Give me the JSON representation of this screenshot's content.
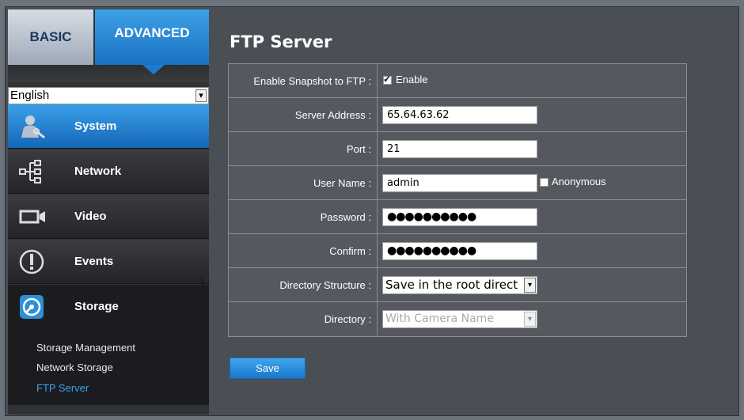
{
  "tabs": {
    "basic": "BASIC",
    "advanced": "ADVANCED"
  },
  "language": {
    "selected": "English",
    "arrow": "▾"
  },
  "nav": [
    {
      "label": "System",
      "icon": "system-icon",
      "active": true
    },
    {
      "label": "Network",
      "icon": "network-icon",
      "active": false
    },
    {
      "label": "Video",
      "icon": "video-icon",
      "active": false
    },
    {
      "label": "Events",
      "icon": "events-icon",
      "active": false
    },
    {
      "label": "Storage",
      "icon": "storage-icon",
      "active": false
    }
  ],
  "submenu": [
    {
      "label": "Storage Management",
      "active": false
    },
    {
      "label": "Network Storage",
      "active": false
    },
    {
      "label": "FTP Server",
      "active": true
    }
  ],
  "page": {
    "title": "FTP Server"
  },
  "form": {
    "snapshot": {
      "label": "Enable Snapshot to FTP :",
      "checkbox_label": "Enable",
      "checked": true
    },
    "server": {
      "label": "Server Address :",
      "value": "65.64.63.62"
    },
    "port": {
      "label": "Port :",
      "value": "21"
    },
    "username": {
      "label": "User Name :",
      "value": "admin",
      "anonymous_label": "Anonymous",
      "anonymous_checked": false
    },
    "password": {
      "label": "Password :",
      "value": "●●●●●●●●●●"
    },
    "confirm": {
      "label": "Confirm :",
      "value": "●●●●●●●●●●"
    },
    "dir_structure": {
      "label": "Directory Structure :",
      "value": "Save in the root direct"
    },
    "directory": {
      "label": "Directory :",
      "value": "With Camera Name",
      "disabled": true
    }
  },
  "save_label": "Save",
  "colors": {
    "accent": "#1f7bcc",
    "active_link": "#3aa0e8",
    "background": "#4a4e55"
  }
}
